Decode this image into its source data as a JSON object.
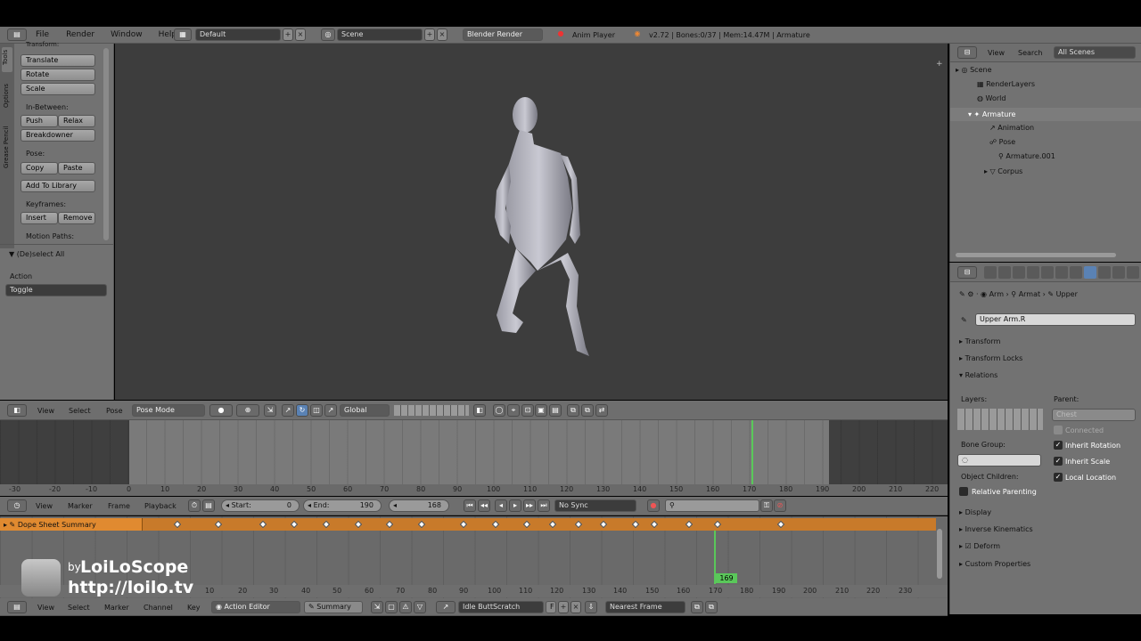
{
  "topbar": {
    "menus": [
      "File",
      "Render",
      "Window",
      "Help"
    ],
    "layout": "Default",
    "scene": "Scene",
    "engine": "Blender Render",
    "anim_player": "Anim Player",
    "stats": "v2.72 | Bones:0/37 | Mem:14.47M | Armature"
  },
  "toolshelf": {
    "tabs": [
      "Tools",
      "Options",
      "Grease Pencil"
    ],
    "section": "Transform:",
    "translate": "Translate",
    "rotate": "Rotate",
    "scale": "Scale",
    "inbetween": "In-Between:",
    "push": "Push",
    "relax": "Relax",
    "breakdowner": "Breakdowner",
    "pose": "Pose:",
    "copy": "Copy",
    "paste": "Paste",
    "add_library": "Add To Library",
    "keyframes": "Keyframes:",
    "insert": "Insert",
    "remove": "Remove",
    "motion_paths": "Motion Paths:",
    "operator": "(De)select All",
    "action_label": "Action",
    "action_value": "Toggle"
  },
  "view3d_header": {
    "view": "View",
    "select": "Select",
    "pose": "Pose",
    "mode": "Pose Mode",
    "orientation": "Global"
  },
  "timeline": {
    "ticks": [
      "-30",
      "-20",
      "-10",
      "0",
      "10",
      "20",
      "30",
      "40",
      "50",
      "60",
      "70",
      "80",
      "90",
      "100",
      "110",
      "120",
      "130",
      "140",
      "150",
      "160",
      "170",
      "180",
      "190",
      "200",
      "210",
      "220"
    ],
    "view": "View",
    "marker": "Marker",
    "frame": "Frame",
    "playback": "Playback",
    "start_label": "Start:",
    "start_value": "0",
    "end_label": "End:",
    "end_value": "190",
    "current": "168",
    "sync": "No Sync"
  },
  "dopesheet": {
    "summary": "Dope Sheet Summary",
    "ticks": [
      "10",
      "20",
      "30",
      "40",
      "50",
      "60",
      "70",
      "80",
      "90",
      "100",
      "110",
      "120",
      "130",
      "140",
      "150",
      "160",
      "170",
      "180",
      "190",
      "200",
      "210",
      "220",
      "230"
    ],
    "frame_badge": "169",
    "view": "View",
    "select": "Select",
    "marker": "Marker",
    "channel": "Channel",
    "key": "Key",
    "mode": "Action Editor",
    "summary_btn": "Summary",
    "action": "Idle ButtScratch",
    "action_f": "F",
    "snap": "Nearest Frame"
  },
  "watermark": {
    "by": "by",
    "brand": "LoiLoScope",
    "url": "http://loilo.tv"
  },
  "outliner": {
    "view": "View",
    "search": "Search",
    "filter": "All Scenes",
    "items": [
      "Scene",
      "RenderLayers",
      "World",
      "Armature",
      "Animation",
      "Pose",
      "Armature.001",
      "Corpus"
    ]
  },
  "properties": {
    "crumbs": [
      "Arm",
      "Armat",
      "Upper"
    ],
    "bone_name": "Upper Arm.R",
    "panels": [
      "Transform",
      "Transform Locks",
      "Relations"
    ],
    "layers": "Layers:",
    "parent": "Parent:",
    "parent_value": "Chest",
    "connected": "Connected",
    "bone_group": "Bone Group:",
    "inherit_rotation": "Inherit Rotation",
    "inherit_scale": "Inherit Scale",
    "object_children": "Object Children:",
    "local_location": "Local Location",
    "relative_parenting": "Relative Parenting",
    "panels2": [
      "Display",
      "Inverse Kinematics",
      "Deform",
      "Custom Properties"
    ]
  }
}
